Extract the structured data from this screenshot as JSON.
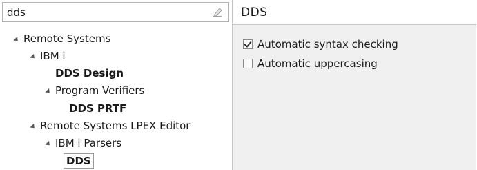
{
  "filter": {
    "value": "dds",
    "clear_icon": "clear-filter-icon"
  },
  "tree": {
    "remote_systems": "Remote Systems",
    "ibm_i": "IBM i",
    "dds_design": "DDS Design",
    "program_verifiers": "Program Verifiers",
    "dds_prtf": "DDS PRTF",
    "lpex_editor": "Remote Systems LPEX Editor",
    "ibm_i_parsers": "IBM i Parsers",
    "dds": "DDS"
  },
  "page": {
    "title": "DDS"
  },
  "options": {
    "syntax_checking": {
      "label": "Automatic syntax checking",
      "checked": true
    },
    "uppercasing": {
      "label": "Automatic uppercasing",
      "checked": false
    }
  }
}
